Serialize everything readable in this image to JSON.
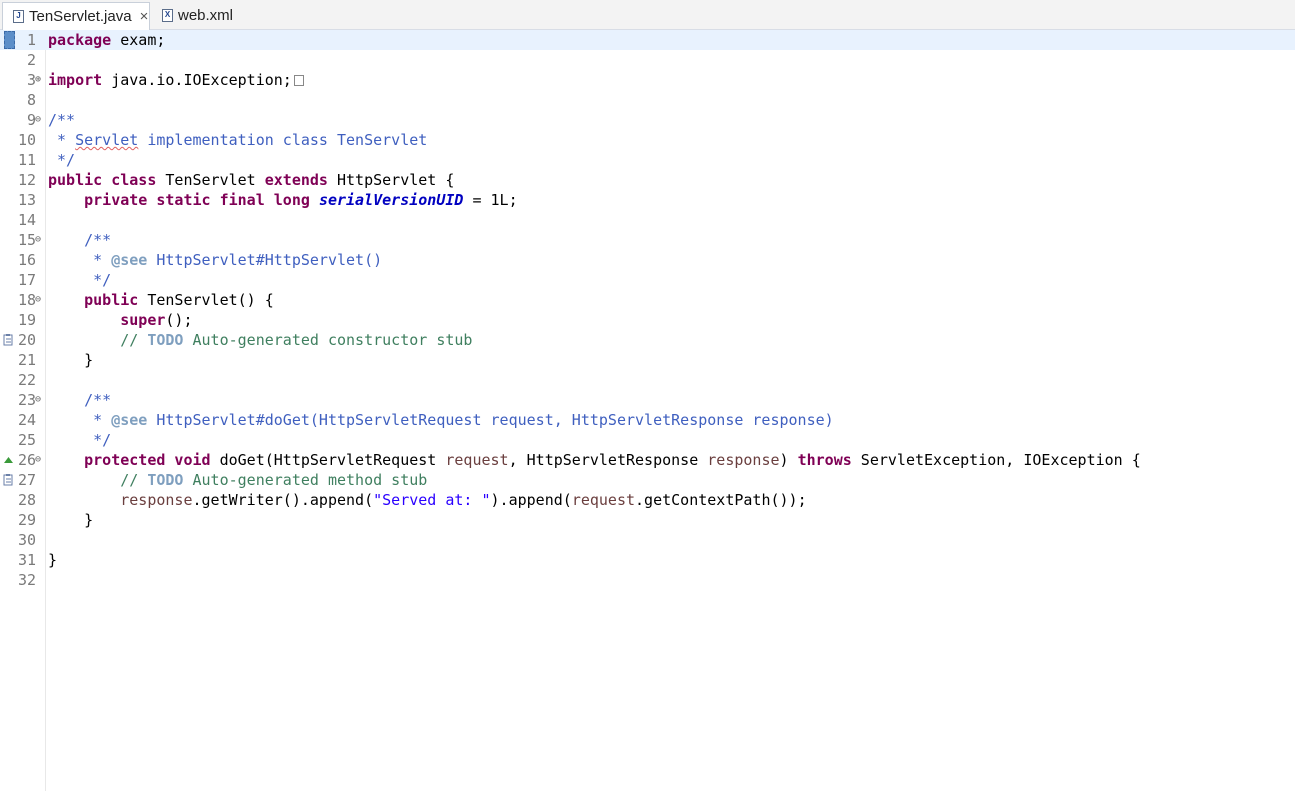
{
  "tabs": [
    {
      "label": "TenServlet.java",
      "icon": "java-file-icon",
      "active": true
    },
    {
      "label": "web.xml",
      "icon": "xml-file-icon",
      "active": false
    }
  ],
  "editor": {
    "lines": [
      {
        "n": "1"
      },
      {
        "n": "2"
      },
      {
        "n": "3"
      },
      {
        "n": "8"
      },
      {
        "n": "9"
      },
      {
        "n": "10"
      },
      {
        "n": "11"
      },
      {
        "n": "12"
      },
      {
        "n": "13"
      },
      {
        "n": "14"
      },
      {
        "n": "15"
      },
      {
        "n": "16"
      },
      {
        "n": "17"
      },
      {
        "n": "18"
      },
      {
        "n": "19"
      },
      {
        "n": "20"
      },
      {
        "n": "21"
      },
      {
        "n": "22"
      },
      {
        "n": "23"
      },
      {
        "n": "24"
      },
      {
        "n": "25"
      },
      {
        "n": "26"
      },
      {
        "n": "27"
      },
      {
        "n": "28"
      },
      {
        "n": "29"
      },
      {
        "n": "30"
      },
      {
        "n": "31"
      },
      {
        "n": "32"
      }
    ],
    "code": {
      "l1_kw": "package",
      "l1_rest": " exam;",
      "l3_kw": "import",
      "l3_rest": " java.io.IOException;",
      "l9": "/**",
      "l10_a": " * ",
      "l10_squig": "Servlet",
      "l10_b": " implementation class TenServlet",
      "l11": " */",
      "l12_kw1": "public",
      "l12_kw2": "class",
      "l12_name": " TenServlet ",
      "l12_kw3": "extends",
      "l12_rest": " HttpServlet {",
      "l13_kw": "    private static final long ",
      "l13_field": "serialVersionUID",
      "l13_rest": " = 1L;",
      "l15": "    /**",
      "l16_a": "     * ",
      "l16_tag": "@see",
      "l16_b": " HttpServlet#HttpServlet()",
      "l17": "     */",
      "l18_kw": "    public",
      "l18_rest": " TenServlet() {",
      "l19_kw": "        super",
      "l19_rest": "();",
      "l20_a": "        // ",
      "l20_todo": "TODO",
      "l20_b": " Auto-generated constructor stub",
      "l21": "    }",
      "l23": "    /**",
      "l24_a": "     * ",
      "l24_tag": "@see",
      "l24_b": " HttpServlet#doGet(HttpServletRequest request, HttpServletResponse response)",
      "l25": "     */",
      "l26_kw": "    protected void",
      "l26_a": " doGet(HttpServletRequest ",
      "l26_p1": "request",
      "l26_b": ", HttpServletResponse ",
      "l26_p2": "response",
      "l26_c": ") ",
      "l26_kw2": "throws",
      "l26_d": " ServletException, IOException {",
      "l27_a": "        // ",
      "l27_todo": "TODO",
      "l27_b": " Auto-generated method stub",
      "l28_p1": "        response",
      "l28_a": ".getWriter().append(",
      "l28_str": "\"Served at: \"",
      "l28_b": ").append(",
      "l28_p2": "request",
      "l28_c": ".getContextPath());",
      "l29": "    }",
      "l31": "}"
    }
  }
}
